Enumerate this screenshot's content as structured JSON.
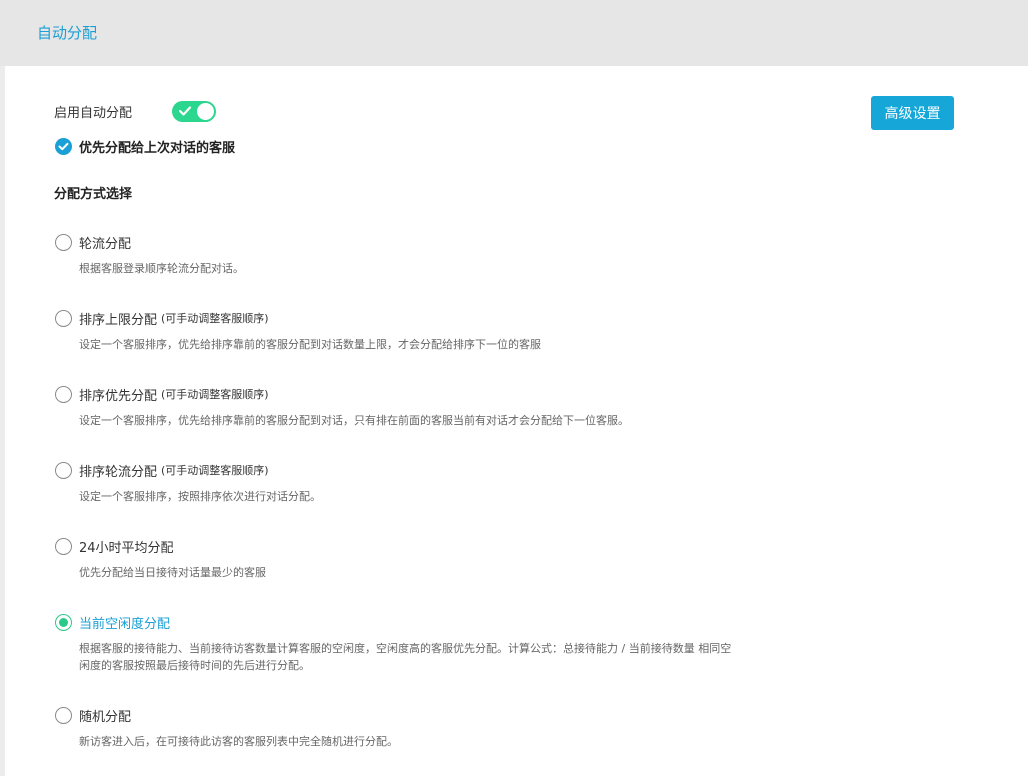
{
  "header": {
    "title": "自动分配"
  },
  "settings": {
    "enable_label": "启用自动分配",
    "enable_on": true,
    "advanced_button": "高级设置",
    "prefer_last_label": "优先分配给上次对话的客服",
    "section_title": "分配方式选择"
  },
  "options": [
    {
      "label": "轮流分配",
      "note": "",
      "desc": "根据客服登录顺序轮流分配对话。",
      "selected": false
    },
    {
      "label": "排序上限分配",
      "note": "(可手动调整客服顺序)",
      "desc": "设定一个客服排序，优先给排序靠前的客服分配到对话数量上限，才会分配给排序下一位的客服",
      "selected": false
    },
    {
      "label": "排序优先分配",
      "note": "(可手动调整客服顺序)",
      "desc": "设定一个客服排序，优先给排序靠前的客服分配到对话，只有排在前面的客服当前有对话才会分配给下一位客服。",
      "selected": false
    },
    {
      "label": "排序轮流分配",
      "note": "(可手动调整客服顺序)",
      "desc": "设定一个客服排序，按照排序依次进行对话分配。",
      "selected": false
    },
    {
      "label": "24小时平均分配",
      "note": "",
      "desc": "优先分配给当日接待对话量最少的客服",
      "selected": false
    },
    {
      "label": "当前空闲度分配",
      "note": "",
      "desc": "根据客服的接待能力、当前接待访客数量计算客服的空闲度，空闲度高的客服优先分配。计算公式：总接待能力 / 当前接待数量 相同空闲度的客服按照最后接待时间的先后进行分配。",
      "selected": true
    },
    {
      "label": "随机分配",
      "note": "",
      "desc": "新访客进入后，在可接待此访客的客服列表中完全随机进行分配。",
      "selected": false
    }
  ],
  "colors": {
    "accent": "#1a9fd6",
    "toggle_on": "#2bd68e",
    "radio_selected": "#2bc98a"
  }
}
